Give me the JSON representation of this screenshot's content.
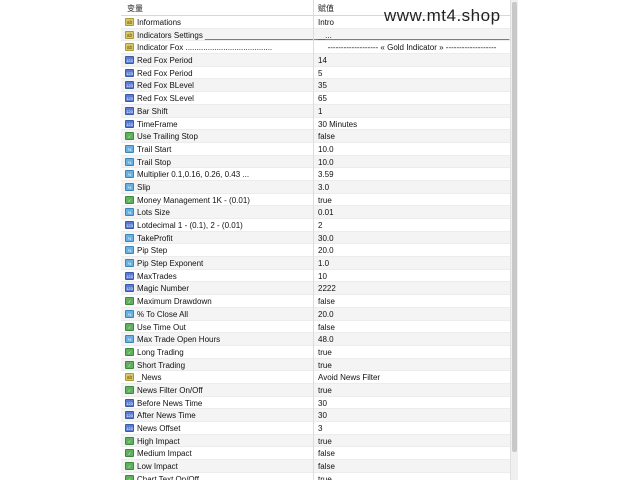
{
  "header": {
    "col_variable": "变量",
    "col_value": "赋值"
  },
  "watermark": "www.mt4.shop",
  "rows": [
    {
      "name": "Informations",
      "value": "Intro",
      "icon": "ab"
    },
    {
      "name": "Indicators Settings ___________________________...",
      "value": "___________________________________________",
      "icon": "ab"
    },
    {
      "name": "Indicator Fox .......................................",
      "value": "------------------- « Gold Indicator » -------------------",
      "icon": "ab"
    },
    {
      "name": "Red Fox Period",
      "value": "14",
      "icon": "num"
    },
    {
      "name": "Red Fox Period",
      "value": "5",
      "icon": "num"
    },
    {
      "name": "Red Fox BLevel",
      "value": "35",
      "icon": "num"
    },
    {
      "name": "Red Fox SLevel",
      "value": "65",
      "icon": "num"
    },
    {
      "name": "Bar Shift",
      "value": "1",
      "icon": "num"
    },
    {
      "name": "TimeFrame",
      "value": "30 Minutes",
      "icon": "num"
    },
    {
      "name": "Use Trailing Stop",
      "value": "false",
      "icon": "bool"
    },
    {
      "name": "Trail Start",
      "value": "10.0",
      "icon": "dbl"
    },
    {
      "name": "Trail Stop",
      "value": "10.0",
      "icon": "dbl"
    },
    {
      "name": "Multiplier 0.1,0.16, 0.26, 0.43 ...",
      "value": "3.59",
      "icon": "dbl"
    },
    {
      "name": "Slip",
      "value": "3.0",
      "icon": "dbl"
    },
    {
      "name": "Money Management 1K - (0.01)",
      "value": "true",
      "icon": "bool"
    },
    {
      "name": "Lots Size",
      "value": "0.01",
      "icon": "dbl"
    },
    {
      "name": "Lotdecimal  1 -  (0.1), 2 -  (0.01)",
      "value": "2",
      "icon": "num"
    },
    {
      "name": "TakeProfit",
      "value": "30.0",
      "icon": "dbl"
    },
    {
      "name": "Pip Step",
      "value": "20.0",
      "icon": "dbl"
    },
    {
      "name": "Pip Step Exponent",
      "value": "1.0",
      "icon": "dbl"
    },
    {
      "name": "MaxTrades",
      "value": "10",
      "icon": "num"
    },
    {
      "name": "Magic Number",
      "value": "2222",
      "icon": "num"
    },
    {
      "name": "Maximum Drawdown",
      "value": "false",
      "icon": "bool"
    },
    {
      "name": "% To Close All",
      "value": "20.0",
      "icon": "dbl"
    },
    {
      "name": "Use Time Out",
      "value": "false",
      "icon": "bool"
    },
    {
      "name": "Max Trade Open Hours",
      "value": "48.0",
      "icon": "dbl"
    },
    {
      "name": "Long Trading",
      "value": "true",
      "icon": "bool"
    },
    {
      "name": "Short Trading",
      "value": "true",
      "icon": "bool"
    },
    {
      "name": "_News",
      "value": "Avoid News Filter",
      "icon": "ab"
    },
    {
      "name": "News Filter On/Off",
      "value": "true",
      "icon": "bool"
    },
    {
      "name": "Before News Time",
      "value": "30",
      "icon": "num"
    },
    {
      "name": "After News Time",
      "value": "30",
      "icon": "num"
    },
    {
      "name": "News Offset",
      "value": "3",
      "icon": "num"
    },
    {
      "name": "High Impact",
      "value": "true",
      "icon": "bool"
    },
    {
      "name": "Medium Impact",
      "value": "false",
      "icon": "bool"
    },
    {
      "name": "Low Impact",
      "value": "false",
      "icon": "bool"
    },
    {
      "name": "Chart Text On/Off",
      "value": "true",
      "icon": "bool"
    }
  ]
}
